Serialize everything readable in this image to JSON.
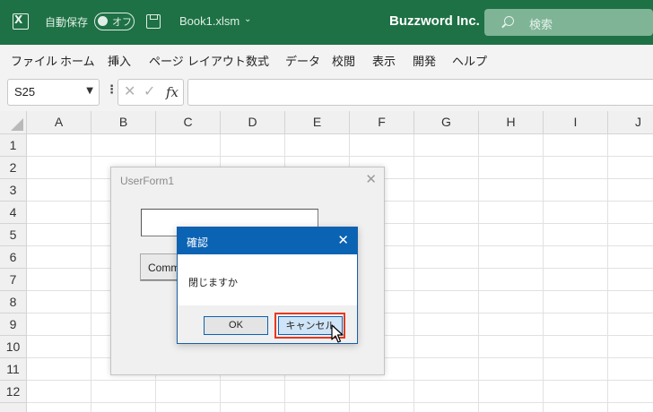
{
  "titlebar": {
    "autosave_label": "自動保存",
    "toggle_label": "オフ",
    "workbook_name": "Book1.xlsm",
    "caret": "⌄",
    "company": "Buzzword Inc.",
    "search_placeholder": "検索",
    "bg_color": "#1e7145",
    "icons": [
      "excel-icon",
      "save-icon",
      "search-icon"
    ]
  },
  "menu": {
    "items": [
      "ファイル",
      "ホーム",
      "挿入",
      "ページ レイアウト",
      "数式",
      "データ",
      "校閲",
      "表示",
      "開発",
      "ヘルプ"
    ]
  },
  "formula_bar": {
    "name_box": "S25",
    "more": "⋮",
    "cancel_glyph": "✕",
    "enter_glyph": "✓",
    "fx_label": "fx",
    "formula": ""
  },
  "grid": {
    "columns": [
      "A",
      "B",
      "C",
      "D",
      "E",
      "F",
      "G",
      "H",
      "I",
      "J"
    ],
    "rows": [
      "1",
      "2",
      "3",
      "4",
      "5",
      "6",
      "7",
      "8",
      "9",
      "10",
      "11",
      "12"
    ]
  },
  "userform": {
    "title": "UserForm1",
    "close": "✕",
    "textbox_value": "",
    "button_label": "Comm"
  },
  "msgbox": {
    "title": "確認",
    "close": "✕",
    "message": "閉じますか",
    "ok_label": "OK",
    "cancel_label": "キャンセル",
    "highlight_color": "#e8381e",
    "title_color": "#0b63b4"
  }
}
